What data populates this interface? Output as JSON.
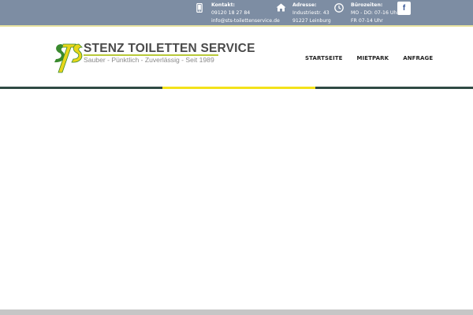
{
  "topbar": {
    "contact": {
      "label": "Kontakt:",
      "phone": "09120 18 27 84",
      "email": "info@sts-toilettenservice.de",
      "icon": "phone-icon"
    },
    "address": {
      "label": "Adresse:",
      "street": "Industriestr. 43",
      "city": "91227 Leinburg",
      "icon": "home-icon"
    },
    "hours": {
      "label": "Bürozeiten:",
      "line1": "MO - DO: 07-16 Uhr",
      "line2": "FR 07-14 Uhr",
      "icon": "clock-icon"
    },
    "facebook": {
      "label": "f",
      "icon": "facebook-icon"
    }
  },
  "logo": {
    "mark": "STS",
    "title": "STENZ TOILETTEN SERVICE",
    "subtitle": "Sauber - Pünktlich - Zuverlässig - Seit 1989"
  },
  "nav": {
    "items": [
      {
        "label": "STARTSEITE"
      },
      {
        "label": "MIETPARK"
      },
      {
        "label": "ANFRAGE"
      }
    ]
  },
  "colors": {
    "topbar": "#7d8da3",
    "accent_dark": "#2f4a43",
    "accent_yellow": "#f3e21a",
    "logo_green": "#3a8a2e",
    "logo_yellow": "#e8d61a"
  }
}
